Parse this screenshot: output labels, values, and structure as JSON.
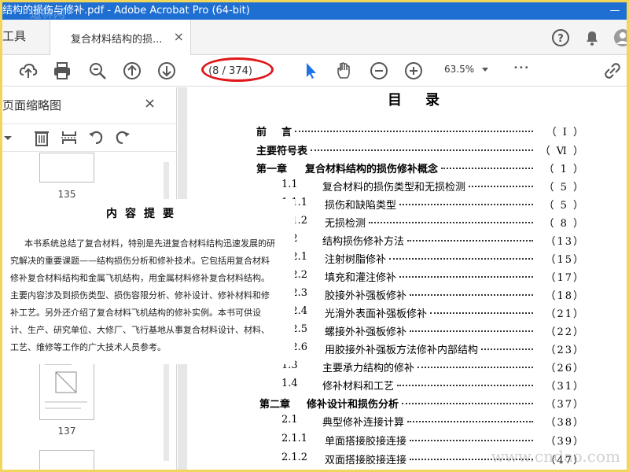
{
  "window": {
    "title": "结构的损伤与修补.pdf - Adobe Acrobat Pro (64-bit)",
    "minimize_glyph": "—"
  },
  "tabs": {
    "tools_label": "工具",
    "doc_tab_label": "复合材料结构的损...",
    "doc_tab_close": "×"
  },
  "toolbar": {
    "page_indicator": "(8 / 374)",
    "zoom_value": "63.5%",
    "more_glyph": "•••"
  },
  "left_panel": {
    "title": "页面缩略图",
    "close_glyph": "×",
    "thumbnails": [
      "135",
      "137"
    ]
  },
  "toc": {
    "title": "目录",
    "entries": [
      {
        "num": "前",
        "text": "言",
        "page": "（ Ⅰ ）",
        "bold": true
      },
      {
        "num": "",
        "text": "主要符号表",
        "page": "（ Ⅵ ）",
        "bold": true
      },
      {
        "num": "第一章",
        "text": "复合材料结构的损伤修补概念",
        "page": "（ 1 ）",
        "bold": true
      },
      {
        "num": "1.1",
        "text": "复合材料的损伤类型和无损检测",
        "page": "（ 5 ）",
        "bold": false
      },
      {
        "num": "1.1.1",
        "text": "损伤和缺陷类型",
        "page": "（ 5 ）",
        "bold": false
      },
      {
        "num": "1.1.2",
        "text": "无损检测",
        "page": "（ 8 ）",
        "bold": false
      },
      {
        "num": "1.2",
        "text": "结构损伤修补方法",
        "page": "（13）",
        "bold": false
      },
      {
        "num": "1.2.1",
        "text": "注射树脂修补",
        "page": "（15）",
        "bold": false
      },
      {
        "num": "1.2.2",
        "text": "填充和灌注修补",
        "page": "（17）",
        "bold": false
      },
      {
        "num": "1.2.3",
        "text": "胶接外补强板修补",
        "page": "（18）",
        "bold": false
      },
      {
        "num": "1.2.4",
        "text": "光滑外表面补强板修补",
        "page": "（21）",
        "bold": false
      },
      {
        "num": "1.2.5",
        "text": "螺接外补强板修补",
        "page": "（22）",
        "bold": false
      },
      {
        "num": "1.2.6",
        "text": "用胶接外补强板方法修补内部结构",
        "page": "（23）",
        "bold": false
      },
      {
        "num": "1.3",
        "text": "主要承力结构的修补",
        "page": "（26）",
        "bold": false
      },
      {
        "num": "1.4",
        "text": "修补材料和工艺",
        "page": "（31）",
        "bold": false
      },
      {
        "num": "第二章",
        "text": "修补设计和损伤分析",
        "page": "（37）",
        "bold": true
      },
      {
        "num": "2.1",
        "text": "典型修补连接计算",
        "page": "（38）",
        "bold": false
      },
      {
        "num": "2.1.1",
        "text": "单面搭接胶接连接",
        "page": "（39）",
        "bold": false
      },
      {
        "num": "2.1.2",
        "text": "双面搭接胶接连接",
        "page": "（47）",
        "bold": false
      }
    ]
  },
  "abstract": {
    "title": "内容提要",
    "lines": [
      "本书系统总结了复合材料，特别是先进复合材料结构迅速发展的研",
      "究解决的重要课题——结构损伤分析和修补技术。它包括用复合材料",
      "修补复合材料结构和金属飞机结构，用金属材料修补复合材料结构。",
      "主要内容涉及到损伤类型、损伤容限分析、修补设计、修补材料和修",
      "补工艺。另外还介绍了复合材料飞机结构的修补实例。本书可供设",
      "计、生产、研究单位、大修厂、飞行基地从事复合材料设计、材料、",
      "工艺、维修等工作的广大技术人员参考。"
    ]
  },
  "watermarks": {
    "bottom": "www.cndao.com",
    "top": "道林网"
  },
  "colors": {
    "titlebar": "#1f6fd3",
    "highlight_ellipse": "#e0171b",
    "frame": "#f1d65a",
    "cursor_blue": "#1a73e8"
  }
}
